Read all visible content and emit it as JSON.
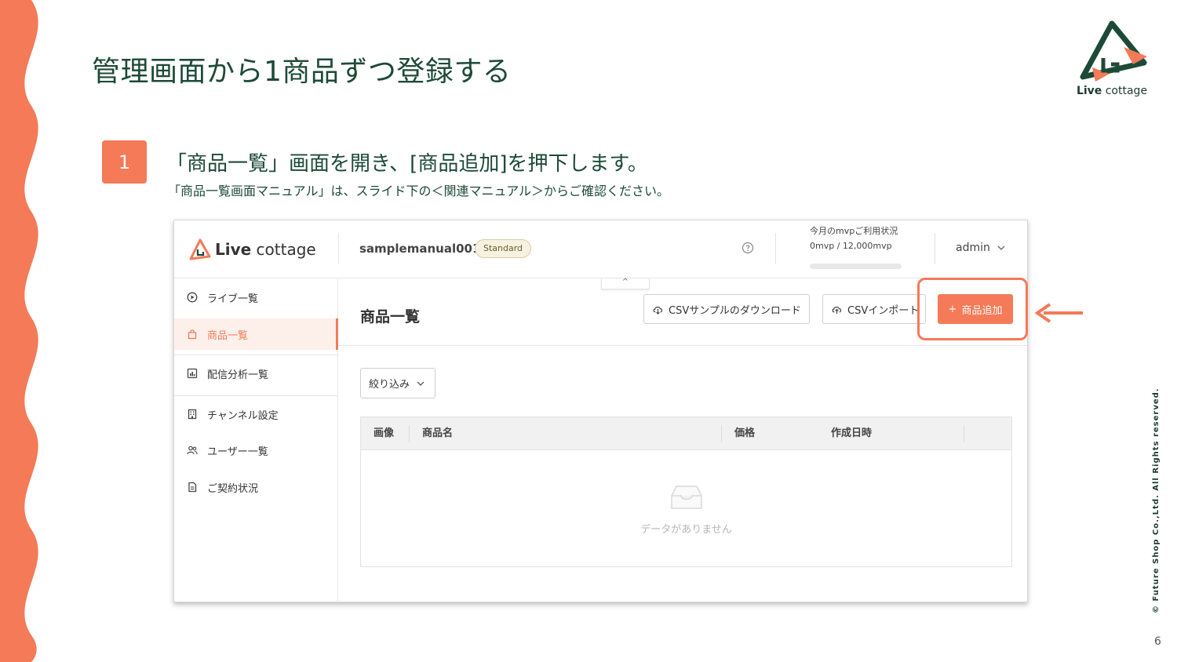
{
  "slide": {
    "title": "管理画面から1商品ずつ登録する",
    "brand": {
      "name_bold": "Live",
      "name_rest": " cottage"
    },
    "step": {
      "number": "1",
      "heading": "「商品一覧」画面を開き、[商品追加]を押下します。",
      "sub": "「商品一覧画面マニュアル」は、スライド下の＜関連マニュアル＞からご確認ください。"
    },
    "copyright": "© Future Shop Co.,Ltd. All Rights reserved.",
    "page_number": "6",
    "accent_color": "#f47a58",
    "title_color": "#1d4a38"
  },
  "app": {
    "logo": {
      "bold": "Live",
      "rest": " cottage"
    },
    "account_name": "samplemanual001",
    "plan_badge": "Standard",
    "help_icon": "question-circle-icon",
    "usage": {
      "title": "今月のmvpご利用状況",
      "value": "0mvp / 12,000mvp",
      "fraction": 0
    },
    "admin_label": "admin",
    "sidebar": {
      "items": [
        {
          "label": "ライブ一覧",
          "icon": "play-circle-icon",
          "active": false
        },
        {
          "label": "商品一覧",
          "icon": "shopping-bag-icon",
          "active": true
        },
        {
          "label": "配信分析一覧",
          "icon": "chart-icon",
          "active": false
        },
        {
          "label": "チャンネル設定",
          "icon": "building-icon",
          "active": false
        },
        {
          "label": "ユーザー一覧",
          "icon": "users-icon",
          "active": false
        },
        {
          "label": "ご契約状況",
          "icon": "document-icon",
          "active": false
        }
      ]
    },
    "collapse_label": "^",
    "main": {
      "title": "商品一覧",
      "csv_sample_button": "CSVサンプルのダウンロード",
      "csv_import_button": "CSVインポート",
      "add_product_button": "商品追加",
      "add_symbol": "+",
      "filter_button": "絞り込み",
      "table": {
        "columns": [
          "画像",
          "商品名",
          "価格",
          "作成日時"
        ],
        "empty_text": "データがありません"
      }
    }
  }
}
